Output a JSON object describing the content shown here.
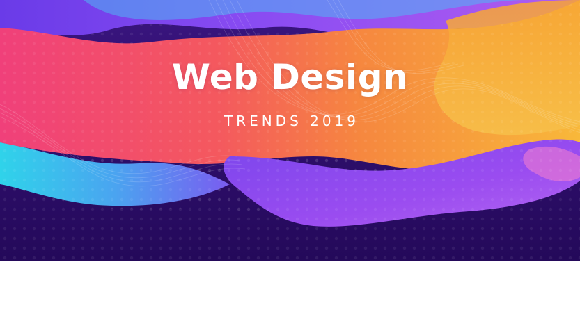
{
  "banner": {
    "title": "Web Design",
    "subtitle": "TRENDS 2019",
    "colors": {
      "background": "#2a0f63",
      "pink": "#f2456f",
      "orange": "#f7a033",
      "purple": "#8b4cf0",
      "cyan": "#3ec9e6",
      "text": "#ffffff"
    }
  }
}
